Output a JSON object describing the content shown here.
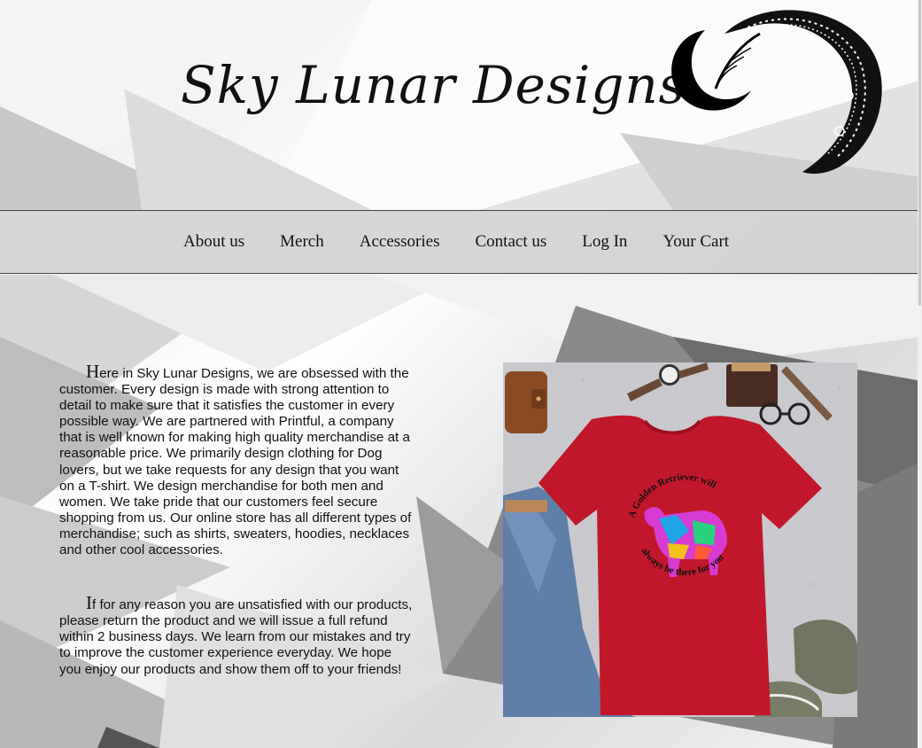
{
  "site": {
    "title": "Sky Lunar Designs",
    "logo_icon": "crescent-moon-mandala"
  },
  "nav": {
    "items": [
      {
        "label": "About us"
      },
      {
        "label": "Merch"
      },
      {
        "label": "Accessories"
      },
      {
        "label": "Contact us"
      },
      {
        "label": "Log In"
      },
      {
        "label": "Your Cart"
      }
    ]
  },
  "main": {
    "paragraph1": {
      "dropcap": "H",
      "text": "ere in Sky Lunar Designs, we are obsessed with the customer. Every design is made with strong attention to detail to make sure that it satisfies the customer in every possible way. We are partnered with Printful, a company that is well known for making high quality merchandise at a reasonable price. We primarily design clothing for Dog lovers, but we take requests for any design that you want on a T-shirt. We design merchandise for both men and women. We take pride that our customers feel secure shopping from us. Our online store has all different types of merchandise; such as shirts, sweaters, hoodies, necklaces and other cool accessories."
    },
    "paragraph2": {
      "dropcap": "I",
      "text": "f for any reason you are unsatisfied with our products, please return the product and we will issue a full refund within 2 business days. We learn from our mistakes and try to improve the customer experience everyday. We hope you enjoy our products and show them off to your friends!"
    },
    "product_image": {
      "shirt_text_top": "A Golden Retriever will",
      "shirt_text_bottom": "always be there for you"
    }
  },
  "colors": {
    "shirt": "#c0182a",
    "nav_bg": "#d2d2d2",
    "text": "#111111"
  }
}
